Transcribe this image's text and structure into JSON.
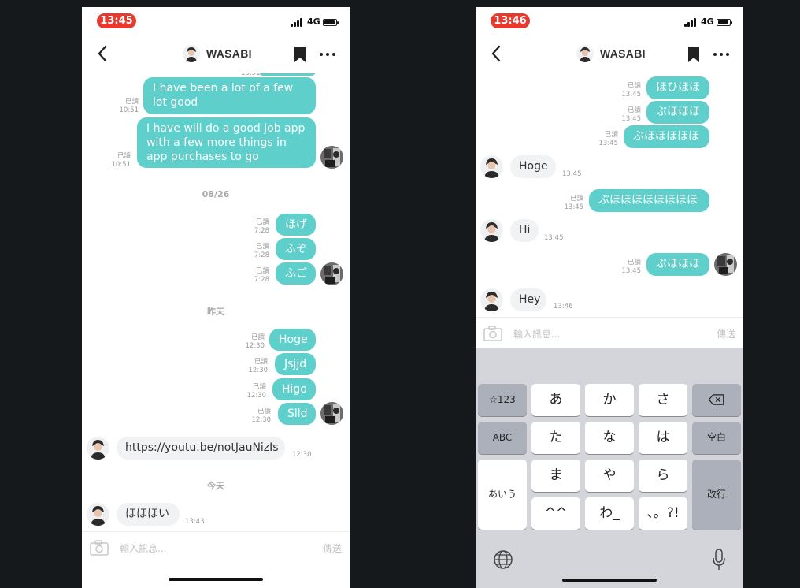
{
  "colors": {
    "outgoing": "#5ecfca",
    "incoming": "#f1f2f4",
    "status_time": "#e8392f"
  },
  "left": {
    "status_time": "13:45",
    "network": "4G",
    "title": "WASABI",
    "top_clip_time": "10:51",
    "outgoing_1": {
      "text": "I have been a lot of a few lot good",
      "read": "已讀",
      "time": "10:51"
    },
    "outgoing_2": {
      "text": "I have will do a good job app with a few more things in app purchases to go",
      "read": "已讀",
      "time": "10:51"
    },
    "date_1": "08/26",
    "group_1": [
      {
        "text": "ほげ",
        "read": "已讀",
        "time": "7:28"
      },
      {
        "text": "ふぞ",
        "read": "已讀",
        "time": "7:28"
      },
      {
        "text": "ふご",
        "read": "已讀",
        "time": "7:28"
      }
    ],
    "date_2": "昨天",
    "group_2": [
      {
        "text": "Hoge",
        "read": "已讀",
        "time": "12:30"
      },
      {
        "text": "Jsjjd",
        "read": "已讀",
        "time": "12:30"
      },
      {
        "text": "Higo",
        "read": "已讀",
        "time": "12:30"
      },
      {
        "text": "Slld",
        "read": "已讀",
        "time": "12:30"
      }
    ],
    "incoming_link": {
      "text": "https://youtu.be/notJauNizIs",
      "time": "12:30"
    },
    "date_3": "今天",
    "incoming_last": {
      "text": "ほほほい",
      "time": "13:43"
    },
    "input_placeholder": "輸入訊息...",
    "send_label": "傳送"
  },
  "right": {
    "status_time": "13:46",
    "network": "4G",
    "title": "WASABI",
    "group_1": [
      {
        "text": "ほひほほ",
        "read": "已讀",
        "time": "13:45"
      },
      {
        "text": "ぶほほほ",
        "read": "已讀",
        "time": "13:45"
      },
      {
        "text": "ぶほほほほほ",
        "read": "已讀",
        "time": "13:45"
      }
    ],
    "incoming_1": {
      "text": "Hoge",
      "time": "13:45"
    },
    "outgoing_2": {
      "text": "ぶほほほほほほほほ",
      "read": "已讀",
      "time": "13:45"
    },
    "incoming_2": {
      "text": "Hi",
      "time": "13:45"
    },
    "outgoing_3": {
      "text": "ぶほほほ",
      "read": "已讀",
      "time": "13:45"
    },
    "incoming_3": {
      "text": "Hey",
      "time": "13:46"
    },
    "input_placeholder": "輸入訊息...",
    "send_label": "傳送",
    "keyboard": {
      "row1": [
        "☆123",
        "あ",
        "か",
        "さ"
      ],
      "row2": [
        "ABC",
        "た",
        "な",
        "は",
        "空白"
      ],
      "row3": [
        "あいう",
        "ま",
        "や",
        "ら",
        "改行"
      ],
      "row4": [
        "^^",
        "わ_",
        "、。?!"
      ],
      "icons": [
        "delete-icon",
        "globe-icon",
        "mic-icon"
      ]
    }
  }
}
